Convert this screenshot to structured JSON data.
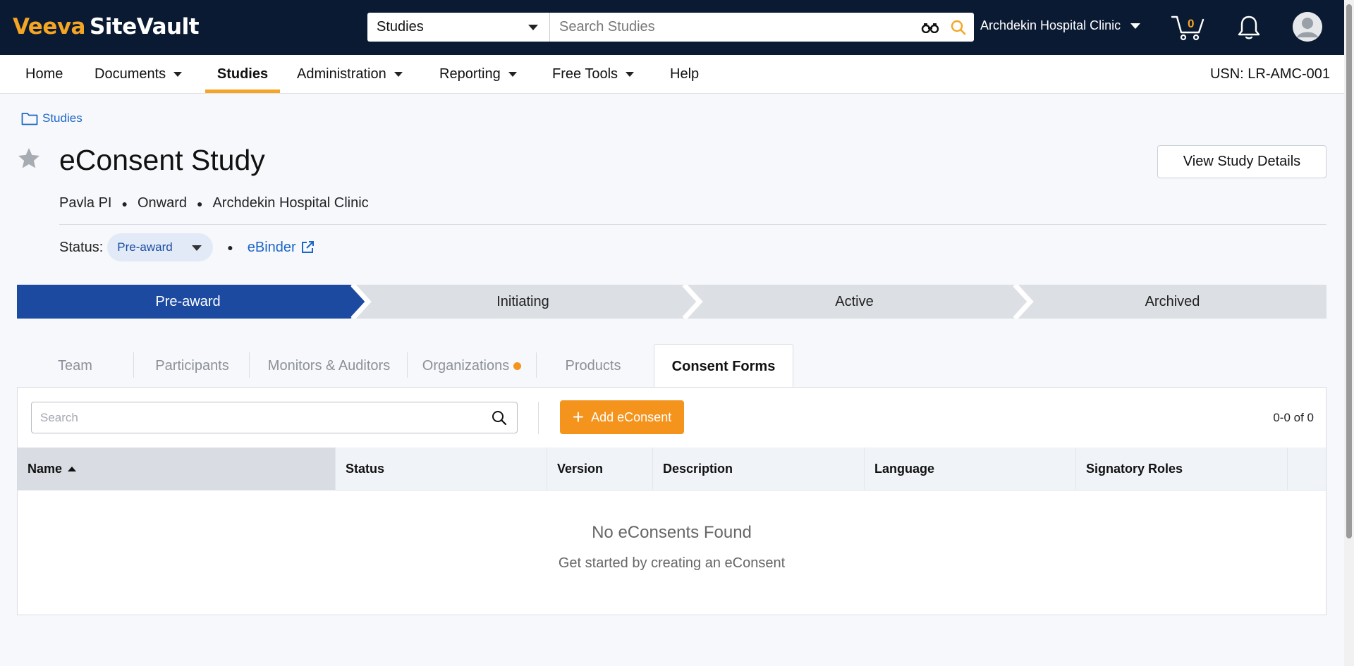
{
  "brand": {
    "veeva": "Veeva",
    "product": "SiteVault",
    "accent": "#f5a524"
  },
  "search": {
    "scope": "Studies",
    "placeholder": "Search Studies"
  },
  "org": {
    "name": "Archdekin Hospital Clinic"
  },
  "cart": {
    "count": "0"
  },
  "nav": {
    "items": [
      {
        "label": "Home"
      },
      {
        "label": "Documents"
      },
      {
        "label": "Studies"
      },
      {
        "label": "Administration"
      },
      {
        "label": "Reporting"
      },
      {
        "label": "Free Tools"
      },
      {
        "label": "Help"
      }
    ],
    "active": "Studies",
    "usn": "USN: LR-AMC-001"
  },
  "breadcrumb": {
    "label": "Studies"
  },
  "study": {
    "title": "eConsent Study",
    "view_details": "View Study Details",
    "pi": "Pavla PI",
    "sponsor": "Onward",
    "site": "Archdekin Hospital Clinic",
    "status_label": "Status:",
    "status_value": "Pre-award",
    "ebinder": "eBinder"
  },
  "stages": [
    {
      "label": "Pre-award",
      "active": true
    },
    {
      "label": "Initiating",
      "active": false
    },
    {
      "label": "Active",
      "active": false
    },
    {
      "label": "Archived",
      "active": false
    }
  ],
  "tabs": [
    {
      "label": "Team"
    },
    {
      "label": "Participants"
    },
    {
      "label": "Monitors & Auditors"
    },
    {
      "label": "Organizations"
    },
    {
      "label": "Products"
    },
    {
      "label": "Consent Forms"
    }
  ],
  "panel": {
    "search_placeholder": "Search",
    "add_label": "Add eConsent",
    "count": "0-0 of 0",
    "columns": [
      "Name",
      "Status",
      "Version",
      "Description",
      "Language",
      "Signatory Roles"
    ],
    "empty_title": "No eConsents Found",
    "empty_sub": "Get started by creating an eConsent"
  },
  "colors": {
    "navy": "#0b1a33",
    "stage_active": "#1c4aa1",
    "stage_inactive": "#dcdfe3",
    "orange": "#f5941d",
    "link": "#1b66c9"
  }
}
